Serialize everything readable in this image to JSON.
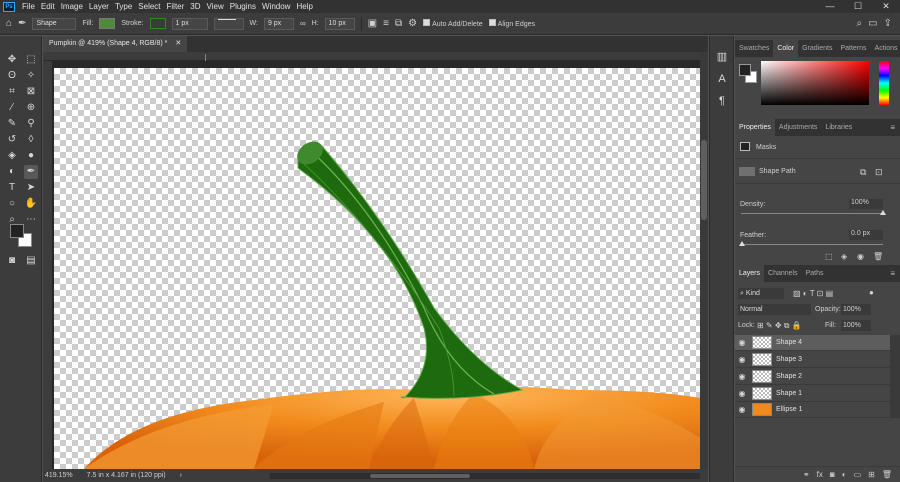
{
  "app": {
    "logo": "Ps"
  },
  "menu": [
    "File",
    "Edit",
    "Image",
    "Layer",
    "Type",
    "Select",
    "Filter",
    "3D",
    "View",
    "Plugins",
    "Window",
    "Help"
  ],
  "window_controls": {
    "minimize": "—",
    "maximize": "☐",
    "close": "✕"
  },
  "options_bar": {
    "mode": "Shape",
    "fill_label": "Fill:",
    "fill_color": "#4f8a3a",
    "stroke_label": "Stroke:",
    "stroke_color": "#2e8a1e",
    "stroke_width": "1 px",
    "w_label": "W:",
    "w_value": "9 px",
    "h_label": "H:",
    "h_value": "10 px",
    "auto_add_delete": "Auto Add/Delete",
    "align_edges": "Align Edges"
  },
  "document": {
    "tab_title": "Pumpkin @ 419% (Shape 4, RGB/8) *",
    "zoom": "419.15%",
    "doc_size": "7.5 in x 4.167 in (120 ppi)"
  },
  "right_icons": [
    "history-icon",
    "character-icon",
    "paragraph-icon"
  ],
  "color_panel": {
    "tabs": [
      "Swatches",
      "Color",
      "Gradients",
      "Patterns",
      "Actions"
    ],
    "active_tab": "Color",
    "hue_color": "#ff0000"
  },
  "properties_panel": {
    "tabs": [
      "Properties",
      "Adjustments",
      "Libraries"
    ],
    "active_tab": "Properties",
    "masks_label": "Masks",
    "shape_path_label": "Shape Path",
    "density_label": "Density:",
    "density_value": "100%",
    "feather_label": "Feather:",
    "feather_value": "0.0 px"
  },
  "layers_panel": {
    "tabs": [
      "Layers",
      "Channels",
      "Paths"
    ],
    "active_tab": "Layers",
    "filter_kind": "Kind",
    "blend_mode": "Normal",
    "opacity_label": "Opacity:",
    "opacity_value": "100%",
    "lock_label": "Lock:",
    "fill_label": "Fill:",
    "fill_value": "100%",
    "layers": [
      {
        "name": "Shape 4",
        "selected": true
      },
      {
        "name": "Shape 3",
        "selected": false
      },
      {
        "name": "Shape 2",
        "selected": false
      },
      {
        "name": "Shape 1",
        "selected": false
      },
      {
        "name": "Ellipse 1",
        "selected": false
      }
    ],
    "footer_icons": [
      "link-icon",
      "fx-icon",
      "mask-icon",
      "adjustment-icon",
      "folder-icon",
      "new-layer-icon",
      "trash-icon"
    ]
  },
  "colors": {
    "foreground": "#222222",
    "background": "#ffffff",
    "stem": "#1f6e0f",
    "pumpkin": "#f08a1c"
  }
}
